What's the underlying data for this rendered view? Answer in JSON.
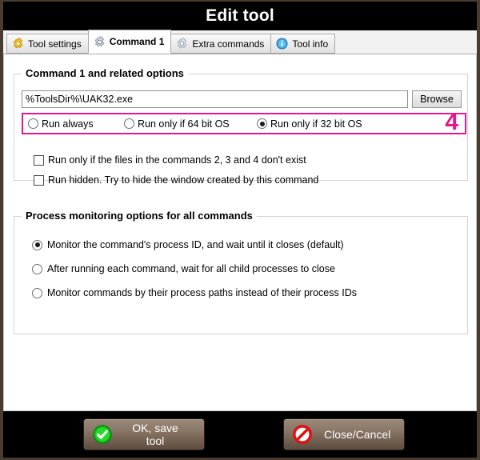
{
  "window": {
    "title": "Edit tool",
    "frame_color": "#4a3b30",
    "titlebar_color": "#000000"
  },
  "tabs": [
    {
      "label": "Tool settings",
      "icon": "gear-icon-yellow",
      "active": false
    },
    {
      "label": "Command 1",
      "icon": "gear-icon-gray",
      "active": true
    },
    {
      "label": "Extra commands",
      "icon": "gear-icon-gray",
      "active": false
    },
    {
      "label": "Tool info",
      "icon": "info-icon-blue",
      "active": false
    }
  ],
  "command_group": {
    "title": "Command 1 and related options",
    "command_input": {
      "value": "%ToolsDir%\\UAK32.exe",
      "placeholder": ""
    },
    "browse_label": "Browse",
    "run_mode_options": [
      {
        "label": "Run always",
        "selected": false
      },
      {
        "label": "Run only if 64 bit OS",
        "selected": false
      },
      {
        "label": "Run only if 32 bit OS",
        "selected": true
      }
    ],
    "annotation": {
      "number": "4",
      "color": "#e6168c"
    },
    "checkboxes": [
      {
        "label": "Run only if the files in the commands 2, 3 and 4 don't exist",
        "checked": false
      },
      {
        "label": "Run hidden. Try to hide the window created by this command",
        "checked": false
      }
    ]
  },
  "monitor_group": {
    "title": "Process monitoring options for all commands",
    "options": [
      {
        "label": "Monitor the command's process ID, and wait until it closes (default)",
        "selected": true
      },
      {
        "label": "After running each command, wait for all child processes to close",
        "selected": false
      },
      {
        "label": "Monitor commands by their process paths instead of their process IDs",
        "selected": false
      }
    ]
  },
  "footer": {
    "ok_label": "OK, save tool",
    "ok_icon": "check-circle-icon-green",
    "cancel_label": "Close/Cancel",
    "cancel_icon": "no-entry-icon-red"
  }
}
